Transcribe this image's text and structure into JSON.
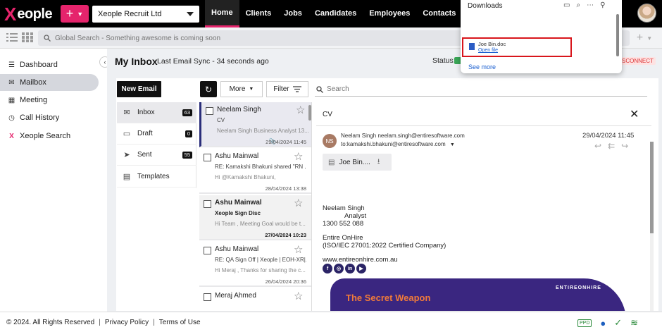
{
  "app": {
    "logo_text": "eople",
    "company": "Xeople Recruit Ltd",
    "nav": [
      "Home",
      "Clients",
      "Jobs",
      "Candidates",
      "Employees",
      "Contacts"
    ]
  },
  "search": {
    "placeholder": "Global Search - Something awesome is coming soon"
  },
  "sidebar": {
    "items": [
      {
        "label": "Dashboard",
        "icon": "dashboard-icon"
      },
      {
        "label": "Mailbox",
        "icon": "mailbox-icon"
      },
      {
        "label": "Meeting",
        "icon": "meeting-icon"
      },
      {
        "label": "Call History",
        "icon": "call-history-icon"
      },
      {
        "label": "Xeople Search",
        "icon": "xeople-search-icon"
      }
    ]
  },
  "inbox": {
    "title": "My Inbox",
    "sync": "Last Email Sync - 34 seconds ago",
    "status_label": "Status:",
    "disconnect": "SCONNECT",
    "toolbar": {
      "new_email": "New Email",
      "more": "More",
      "filter": "Filter",
      "search_placeholder": "Search"
    },
    "folders": [
      {
        "label": "Inbox",
        "count": "63"
      },
      {
        "label": "Draft",
        "count": "0"
      },
      {
        "label": "Sent",
        "count": "55"
      },
      {
        "label": "Templates",
        "count": ""
      }
    ],
    "messages": [
      {
        "from": "Neelam Singh",
        "subject": "CV",
        "preview": "Neelam Singh Business Analyst 13...",
        "date": "29/04/2024 11:45"
      },
      {
        "from": "Ashu Mainwal",
        "subject": "RE: Kamakshi Bhakuni shared \"RN ...",
        "preview": "Hi @Kamakshi Bhakuni,",
        "date": "28/04/2024 13:38"
      },
      {
        "from": "Ashu Mainwal",
        "subject": "Xeople Sign Disc",
        "preview": "Hi Team , Meeting Goal would be t...",
        "date": "27/04/2024 10:23"
      },
      {
        "from": "Ashu Mainwal",
        "subject": "RE: QA Sign Off | Xeople | EOH-XR|...",
        "preview": "Hi Meraj , Thanks for sharing the c...",
        "date": "26/04/2024 20:36"
      },
      {
        "from": "Meraj Ahmed",
        "subject": "",
        "preview": "",
        "date": ""
      }
    ]
  },
  "reader": {
    "title": "CV",
    "initials": "NS",
    "sender": "Neelam Singh neelam.singh@entiresoftware.com",
    "to": "to:kamakshi.bhakuni@entiresoftware.com",
    "date": "29/04/2024 11:45",
    "attachment": "Joe Bin....",
    "signature": {
      "name": "Neelam Singh",
      "role": "Analyst",
      "phone": "1300 552 088",
      "company": "Entire OnHire",
      "cert": "(ISO/IEC 27001:2022 Certified Company)",
      "website": "www.entireonhire.com.au"
    },
    "banner_text": "The Secret Weapon",
    "banner_brand": "ENTIREONHIRE"
  },
  "downloads": {
    "title": "Downloads",
    "file": "Joe Bin.doc",
    "open": "Open file",
    "see_more": "See more"
  },
  "footer": {
    "copyright": "© 2024. All Rights Reserved",
    "privacy": "Privacy Policy",
    "terms": "Terms of Use",
    "ppd": "PPD"
  }
}
